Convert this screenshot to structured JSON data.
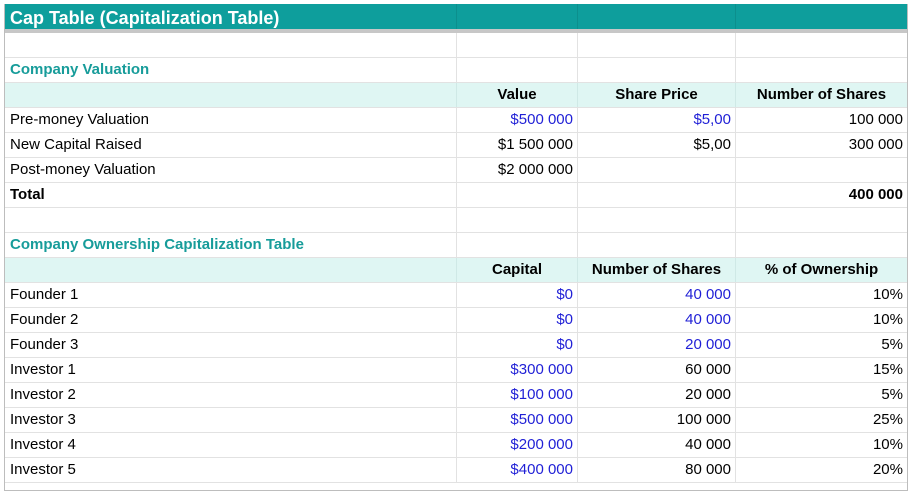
{
  "title": "Cap Table (Capitalization Table)",
  "valuation": {
    "section_title": "Company Valuation",
    "headers": [
      "Value",
      "Share Price",
      "Number of Shares"
    ],
    "rows": [
      {
        "label": "Pre-money Valuation",
        "value": "$500 000",
        "price": "$5,00",
        "shares": "100 000"
      },
      {
        "label": "New Capital Raised",
        "value": "$1 500 000",
        "price": "$5,00",
        "shares": "300 000"
      },
      {
        "label": "Post-money Valuation",
        "value": "$2 000 000",
        "price": "",
        "shares": ""
      }
    ],
    "total": {
      "label": "Total",
      "shares": "400 000"
    }
  },
  "ownership": {
    "section_title": "Company Ownership Capitalization Table",
    "headers": [
      "Capital",
      "Number of Shares",
      "% of Ownership"
    ],
    "rows": [
      {
        "label": "Founder 1",
        "capital": "$0",
        "shares": "40 000",
        "pct": "10%"
      },
      {
        "label": "Founder 2",
        "capital": "$0",
        "shares": "40 000",
        "pct": "10%"
      },
      {
        "label": "Founder 3",
        "capital": "$0",
        "shares": "20 000",
        "pct": "5%"
      },
      {
        "label": "Investor 1",
        "capital": "$300 000",
        "shares": "60 000",
        "pct": "15%"
      },
      {
        "label": "Investor 2",
        "capital": "$100 000",
        "shares": "20 000",
        "pct": "5%"
      },
      {
        "label": "Investor 3",
        "capital": "$500 000",
        "shares": "100 000",
        "pct": "25%"
      },
      {
        "label": "Investor 4",
        "capital": "$200 000",
        "shares": "40 000",
        "pct": "10%"
      },
      {
        "label": "Investor 5",
        "capital": "$400 000",
        "shares": "80 000",
        "pct": "20%"
      }
    ]
  },
  "colors": {
    "title_bg": "#0e9e9c",
    "section_text": "#179c9a",
    "header_bg": "#dff6f3",
    "input_blue": "#1f1fd6"
  }
}
